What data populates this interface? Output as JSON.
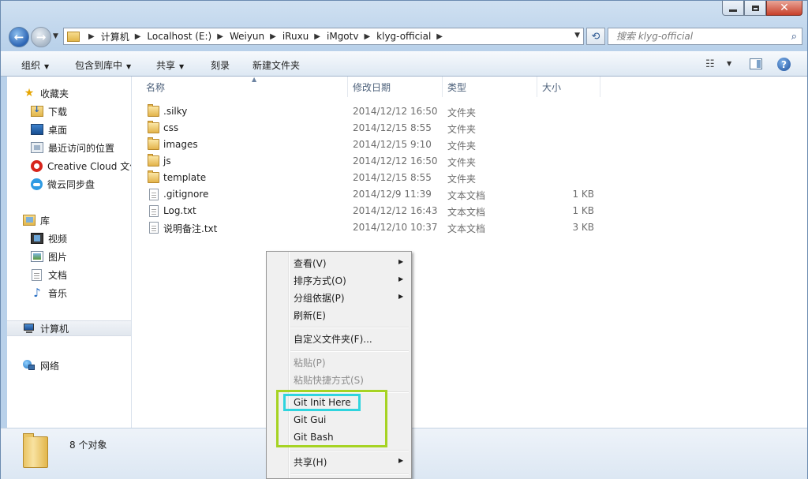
{
  "window": {
    "title_buttons": {
      "minimize": "minimize",
      "maximize": "maximize",
      "close": "close"
    }
  },
  "address": {
    "breadcrumbs": [
      "计算机",
      "Localhost (E:)",
      "Weiyun",
      "iRuxu",
      "iMgotv",
      "klyg-official"
    ]
  },
  "search": {
    "placeholder": "搜索 klyg-official"
  },
  "toolbar": {
    "organize": "组织",
    "include_library": "包含到库中",
    "share": "共享",
    "burn": "刻录",
    "new_folder": "新建文件夹"
  },
  "navpane": {
    "favorites": {
      "label": "收藏夹",
      "items": [
        "下载",
        "桌面",
        "最近访问的位置",
        "Creative Cloud 文件",
        "微云同步盘"
      ]
    },
    "libraries": {
      "label": "库",
      "items": [
        "视频",
        "图片",
        "文档",
        "音乐"
      ]
    },
    "computer": "计算机",
    "network": "网络"
  },
  "columns": {
    "name": "名称",
    "date": "修改日期",
    "type": "类型",
    "size": "大小"
  },
  "files": [
    {
      "name": ".silky",
      "date": "2014/12/12 16:50",
      "type": "文件夹",
      "size": "",
      "kind": "folder"
    },
    {
      "name": "css",
      "date": "2014/12/15 8:55",
      "type": "文件夹",
      "size": "",
      "kind": "folder"
    },
    {
      "name": "images",
      "date": "2014/12/15 9:10",
      "type": "文件夹",
      "size": "",
      "kind": "folder"
    },
    {
      "name": "js",
      "date": "2014/12/12 16:50",
      "type": "文件夹",
      "size": "",
      "kind": "folder"
    },
    {
      "name": "template",
      "date": "2014/12/15 8:55",
      "type": "文件夹",
      "size": "",
      "kind": "folder"
    },
    {
      "name": ".gitignore",
      "date": "2014/12/9 11:39",
      "type": "文本文档",
      "size": "1 KB",
      "kind": "file"
    },
    {
      "name": "Log.txt",
      "date": "2014/12/12 16:43",
      "type": "文本文档",
      "size": "1 KB",
      "kind": "file"
    },
    {
      "name": "说明备注.txt",
      "date": "2014/12/10 10:37",
      "type": "文本文档",
      "size": "3 KB",
      "kind": "file"
    }
  ],
  "details": {
    "count": "8 个对象"
  },
  "context_menu": {
    "view": "查看(V)",
    "sort": "排序方式(O)",
    "group": "分组依据(P)",
    "refresh": "刷新(E)",
    "customize": "自定义文件夹(F)...",
    "paste": "粘贴(P)",
    "paste_shortcut": "粘贴快捷方式(S)",
    "git_init": "Git Init Here",
    "git_gui": "Git Gui",
    "git_bash": "Git Bash",
    "share": "共享(H)"
  },
  "colors": {
    "highlight_green": "#a6d323",
    "highlight_cyan": "#2fd4de"
  }
}
